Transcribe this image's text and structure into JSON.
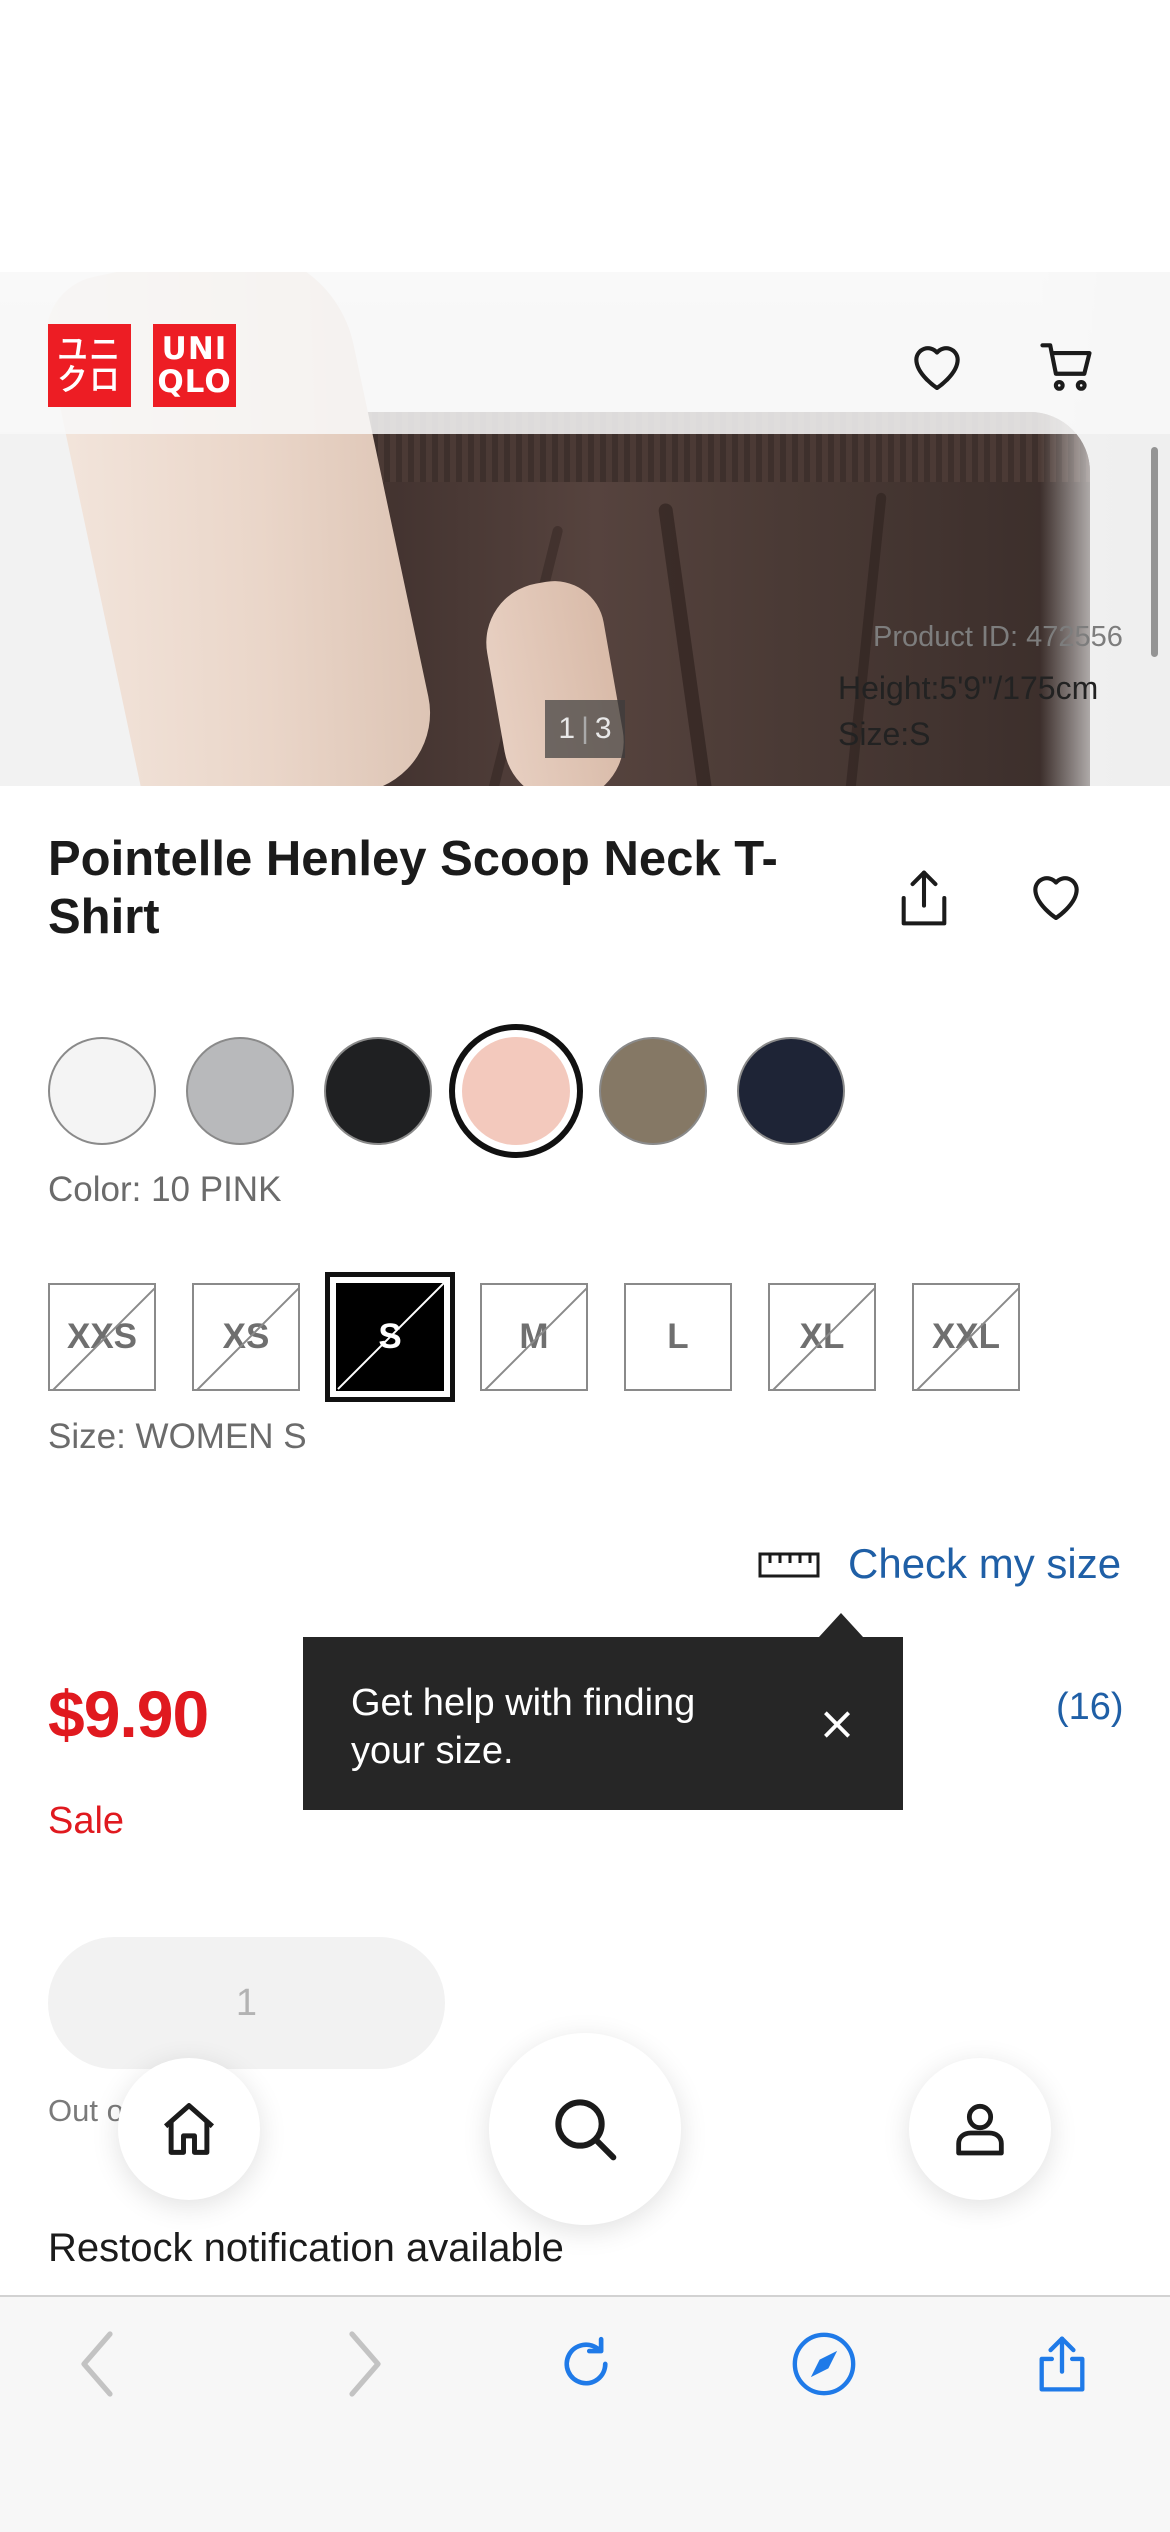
{
  "brand": {
    "logo_left": "ユニクロ",
    "logo_right_line1": "UNI",
    "logo_right_line2": "QLO",
    "red": "#ed1d24"
  },
  "header": {
    "icons": [
      "heart-icon",
      "cart-icon"
    ]
  },
  "gallery": {
    "product_id": "Product ID: 472556",
    "model_height": "Height:5'9''/175cm",
    "model_size": "Size:S",
    "counter_current": "1",
    "counter_separator": "|",
    "counter_total": "3"
  },
  "product": {
    "title": "Pointelle Henley Scoop Neck T-Shirt",
    "title_icons": [
      "share-icon",
      "heart-icon"
    ]
  },
  "colors": {
    "swatches": [
      {
        "name": "white",
        "hex": "#f4f4f4"
      },
      {
        "name": "gray",
        "hex": "#b8b9bb"
      },
      {
        "name": "black",
        "hex": "#1f2022"
      },
      {
        "name": "pink",
        "hex": "#f3c9bd",
        "selected": true
      },
      {
        "name": "olive",
        "hex": "#857865"
      },
      {
        "name": "navy",
        "hex": "#1e2436"
      }
    ],
    "label": "Color: 10 PINK"
  },
  "sizes": {
    "options": [
      {
        "label": "XXS",
        "available": false
      },
      {
        "label": "XS",
        "available": false
      },
      {
        "label": "S",
        "available": false,
        "selected": true
      },
      {
        "label": "M",
        "available": false
      },
      {
        "label": "L",
        "available": true
      },
      {
        "label": "XL",
        "available": false
      },
      {
        "label": "XXL",
        "available": false
      }
    ],
    "label": "Size: WOMEN S"
  },
  "size_help": {
    "link": "Check my size",
    "icon": "ruler-icon"
  },
  "pricing": {
    "price": "$9.90",
    "badge": "Sale",
    "reviews": "(16)",
    "price_color": "#e0191f"
  },
  "tooltip": {
    "text": "Get help with finding your size.",
    "close": "×"
  },
  "purchase": {
    "quantity": "1",
    "stock_status": "Out of stock",
    "restock": "Restock notification available"
  },
  "bottom_nav": [
    "home-icon",
    "search-icon",
    "account-icon"
  ],
  "browser_toolbar": [
    "back-icon",
    "forward-icon",
    "reload-icon",
    "compass-icon",
    "share-icon"
  ],
  "accent_blue": "#1f5fa6",
  "safari_blue": "#1f7ae8"
}
